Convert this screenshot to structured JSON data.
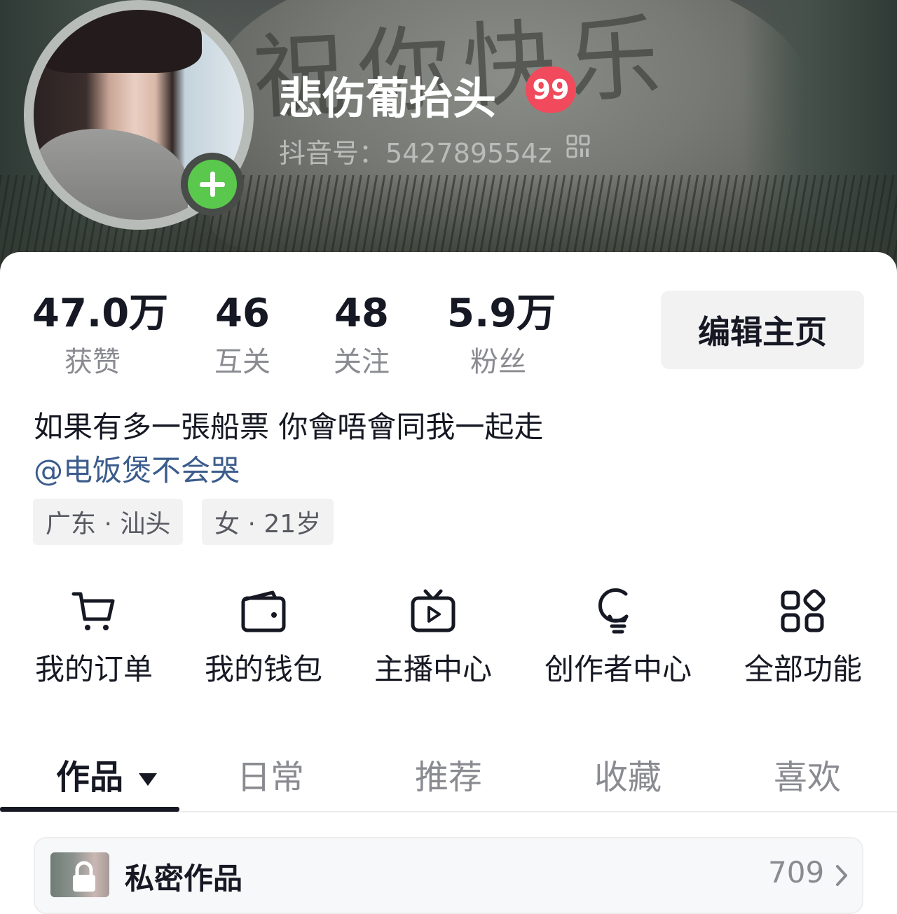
{
  "profile": {
    "nickname": "悲伤葡抬头",
    "message_badge": "99",
    "douyin_id": "抖音号：542789554z",
    "banner_text": "祝你快乐"
  },
  "stats": [
    {
      "value": "47.0万",
      "label": "获赞"
    },
    {
      "value": "46",
      "label": "互关"
    },
    {
      "value": "48",
      "label": "关注"
    },
    {
      "value": "5.9万",
      "label": "粉丝"
    }
  ],
  "edit_button": "编辑主页",
  "bio": {
    "text": "如果有多一張船票 你會唔會同我一起走",
    "mention": "@电饭煲不会哭"
  },
  "tags": [
    "广东 · 汕头",
    "女 · 21岁"
  ],
  "functions": [
    {
      "label": "我的订单",
      "icon": "cart-icon"
    },
    {
      "label": "我的钱包",
      "icon": "wallet-icon"
    },
    {
      "label": "主播中心",
      "icon": "tv-icon"
    },
    {
      "label": "创作者中心",
      "icon": "lightbulb-icon"
    },
    {
      "label": "全部功能",
      "icon": "grid-icon"
    }
  ],
  "tabs": [
    {
      "label": "作品",
      "active": true
    },
    {
      "label": "日常",
      "active": false
    },
    {
      "label": "推荐",
      "active": false
    },
    {
      "label": "收藏",
      "active": false
    },
    {
      "label": "喜欢",
      "active": false
    }
  ],
  "private_works": {
    "label": "私密作品",
    "count": "709"
  },
  "colors": {
    "primary_text": "#161823",
    "secondary_text": "#8a8b91",
    "link": "#3b5c8c",
    "badge": "#f04a5c",
    "add_button": "#5ac84d"
  }
}
